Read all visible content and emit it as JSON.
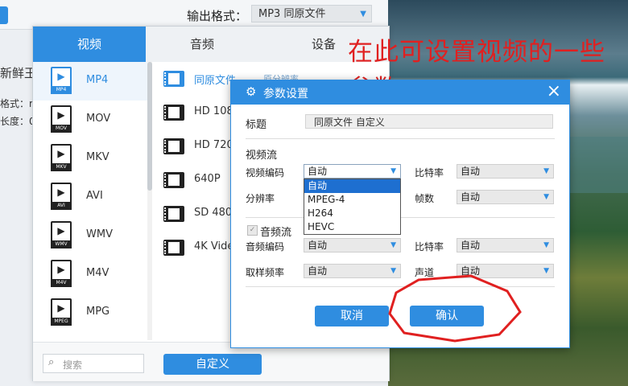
{
  "app": {
    "output_format_label": "输出格式：",
    "output_format_value": "MP3 同原文件",
    "side_texts": [
      "新鲜王",
      "格式：r",
      "长度：0"
    ]
  },
  "tabs": [
    {
      "label": "视频",
      "active": true
    },
    {
      "label": "音频",
      "active": false
    },
    {
      "label": "设备",
      "active": false
    }
  ],
  "formats": [
    {
      "name": "MP4",
      "badge": "MP4",
      "active": true
    },
    {
      "name": "MOV",
      "badge": "MOV",
      "active": false
    },
    {
      "name": "MKV",
      "badge": "MKV",
      "active": false
    },
    {
      "name": "AVI",
      "badge": "AVI",
      "active": false
    },
    {
      "name": "WMV",
      "badge": "WMV",
      "active": false
    },
    {
      "name": "M4V",
      "badge": "M4V",
      "active": false
    },
    {
      "name": "MPG",
      "badge": "MPEG",
      "active": false
    }
  ],
  "presets": [
    {
      "name": "同原文件",
      "extra": "原分辨率",
      "active": true
    },
    {
      "name": "HD 108",
      "extra": "",
      "active": false
    },
    {
      "name": "HD 720",
      "extra": "",
      "active": false
    },
    {
      "name": "640P",
      "extra": "",
      "active": false
    },
    {
      "name": "SD 480",
      "extra": "",
      "active": false
    },
    {
      "name": "4K Vide",
      "extra": "",
      "active": false
    }
  ],
  "search": {
    "placeholder": "搜索"
  },
  "custom_button": "自定义",
  "annotation": "在此可设置视频的一些参数",
  "dialog": {
    "title": "参数设置",
    "title_label": "标题",
    "title_value": "同原文件 自定义",
    "video_section": "视频流",
    "video_codec_label": "视频编码",
    "video_codec_value": "自动",
    "video_bitrate_label": "比特率",
    "video_bitrate_value": "自动",
    "resolution_label": "分辨率",
    "fps_label": "帧数",
    "fps_value": "自动",
    "codec_options": [
      "自动",
      "MPEG-4",
      "H264",
      "HEVC"
    ],
    "codec_selected_index": 0,
    "audio_section": "音频流",
    "audio_checked": true,
    "audio_codec_label": "音频编码",
    "audio_codec_value": "自动",
    "audio_bitrate_label": "比特率",
    "audio_bitrate_value": "自动",
    "sample_rate_label": "取样频率",
    "sample_rate_value": "自动",
    "channel_label": "声道",
    "channel_value": "自动",
    "cancel": "取消",
    "confirm": "确认"
  },
  "colors": {
    "accent": "#2f8de0",
    "annotation": "#e02020"
  }
}
